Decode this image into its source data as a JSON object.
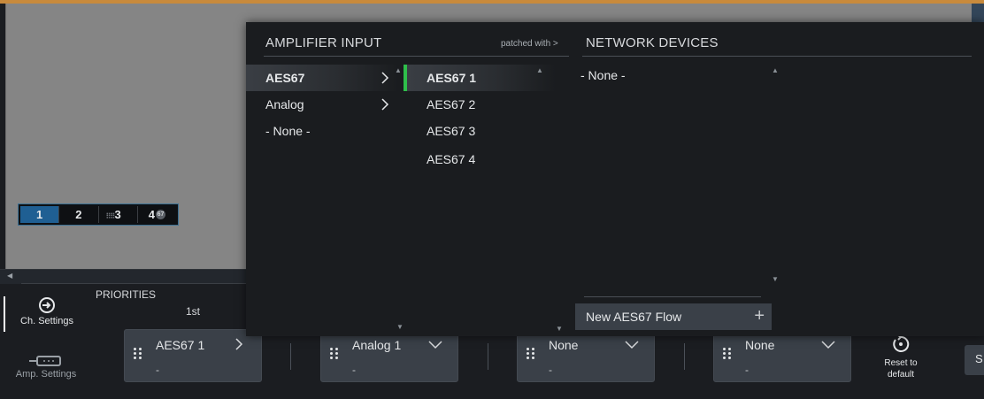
{
  "channels": [
    {
      "number": "1",
      "active": true
    },
    {
      "number": "2",
      "active": false
    },
    {
      "number": "3",
      "active": false
    },
    {
      "number": "4",
      "active": false,
      "badge": "67"
    }
  ],
  "left_tools": {
    "ch_settings": "Ch. Settings",
    "amp_settings": "Amp. Settings"
  },
  "priorities": {
    "label": "PRIORITIES",
    "first": "1st"
  },
  "popup": {
    "amp_input_header": "AMPLIFIER INPUT",
    "patched_with": "patched with >",
    "network_devices_header": "NETWORK DEVICES",
    "input_types": [
      "AES67",
      "Analog",
      "- None -"
    ],
    "aes_streams": [
      "AES67 1",
      "AES67 2",
      "AES67 3",
      "AES67 4"
    ],
    "network_none": "- None -",
    "new_flow": "New AES67 Flow",
    "new_flow_plus": "+"
  },
  "cards": [
    {
      "label": "AES67 1",
      "sub": "-",
      "chevron": "right"
    },
    {
      "label": "Analog 1",
      "sub": "-",
      "chevron": "down"
    },
    {
      "label": "None",
      "sub": "-",
      "chevron": "down"
    },
    {
      "label": "None",
      "sub": "-",
      "chevron": "down"
    }
  ],
  "reset": {
    "line1": "Reset to",
    "line2": "default"
  },
  "s_button": "S",
  "colors": {
    "accent_green": "#2fbf4b",
    "active_channel": "#1f5f93",
    "top_line": "#c88a3c"
  }
}
